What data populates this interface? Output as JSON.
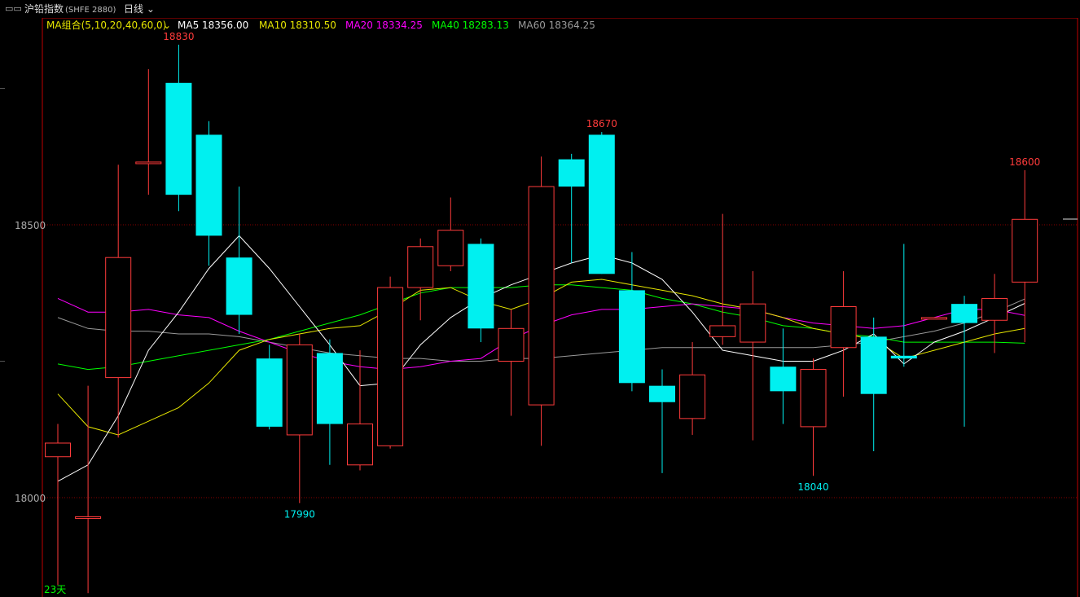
{
  "header": {
    "title": "沪铅指数",
    "code": "(SHFE 2880)",
    "period": "日线",
    "period_icon": "chevron-down-icon",
    "window_icon": "window-icon"
  },
  "ma_legend": {
    "group_label": "MA组合(5,10,20,40,60,0)",
    "ma5": "MA5 18356.00",
    "ma10": "MA10 18310.50",
    "ma20": "MA20 18334.25",
    "ma40": "MA40 18283.13",
    "ma60": "MA60 18364.25"
  },
  "colors": {
    "up": "#ff3b3b",
    "down": "#00f0f0",
    "ma5": "#ffffff",
    "ma10": "#e6e600",
    "ma20": "#ff00ff",
    "ma40": "#00ff00",
    "ma60": "#9a9a9a",
    "frame": "#c00000"
  },
  "chart_data": {
    "type": "candlestick",
    "y_ticks": [
      18000,
      18500
    ],
    "y_range": [
      17850,
      18880
    ],
    "candles": [
      {
        "o": 18075,
        "h": 18135,
        "l": 17840,
        "c": 18100
      },
      {
        "o": 17965,
        "h": 18205,
        "l": 17825,
        "c": 17965
      },
      {
        "o": 18220,
        "h": 18610,
        "l": 18110,
        "c": 18440
      },
      {
        "o": 18615,
        "h": 18785,
        "l": 18555,
        "c": 18615
      },
      {
        "o": 18760,
        "h": 18830,
        "l": 18525,
        "c": 18555
      },
      {
        "o": 18665,
        "h": 18690,
        "l": 18425,
        "c": 18480
      },
      {
        "o": 18440,
        "h": 18570,
        "l": 18300,
        "c": 18335
      },
      {
        "o": 18255,
        "h": 18280,
        "l": 18125,
        "c": 18130
      },
      {
        "o": 18115,
        "h": 18300,
        "l": 17990,
        "c": 18280
      },
      {
        "o": 18265,
        "h": 18290,
        "l": 18060,
        "c": 18135
      },
      {
        "o": 18060,
        "h": 18270,
        "l": 18050,
        "c": 18135
      },
      {
        "o": 18095,
        "h": 18405,
        "l": 18090,
        "c": 18385
      },
      {
        "o": 18385,
        "h": 18475,
        "l": 18325,
        "c": 18460
      },
      {
        "o": 18425,
        "h": 18550,
        "l": 18415,
        "c": 18490
      },
      {
        "o": 18465,
        "h": 18475,
        "l": 18285,
        "c": 18310
      },
      {
        "o": 18250,
        "h": 18345,
        "l": 18150,
        "c": 18310
      },
      {
        "o": 18170,
        "h": 18625,
        "l": 18095,
        "c": 18570
      },
      {
        "o": 18620,
        "h": 18630,
        "l": 18430,
        "c": 18570
      },
      {
        "o": 18665,
        "h": 18670,
        "l": 18410,
        "c": 18410
      },
      {
        "o": 18380,
        "h": 18450,
        "l": 18195,
        "c": 18210
      },
      {
        "o": 18205,
        "h": 18235,
        "l": 18045,
        "c": 18175
      },
      {
        "o": 18145,
        "h": 18285,
        "l": 18115,
        "c": 18225
      },
      {
        "o": 18295,
        "h": 18520,
        "l": 18280,
        "c": 18315
      },
      {
        "o": 18285,
        "h": 18415,
        "l": 18105,
        "c": 18355
      },
      {
        "o": 18240,
        "h": 18310,
        "l": 18135,
        "c": 18195
      },
      {
        "o": 18130,
        "h": 18255,
        "l": 18040,
        "c": 18235
      },
      {
        "o": 18275,
        "h": 18415,
        "l": 18185,
        "c": 18350
      },
      {
        "o": 18295,
        "h": 18330,
        "l": 18085,
        "c": 18190
      },
      {
        "o": 18260,
        "h": 18465,
        "l": 18240,
        "c": 18255
      },
      {
        "o": 18330,
        "h": 18330,
        "l": 18330,
        "c": 18330
      },
      {
        "o": 18355,
        "h": 18370,
        "l": 18130,
        "c": 18320
      },
      {
        "o": 18325,
        "h": 18410,
        "l": 18265,
        "c": 18365
      },
      {
        "o": 18395,
        "h": 18600,
        "l": 18285,
        "c": 18510
      }
    ],
    "ma5": [
      18030,
      18060,
      18150,
      18270,
      18340,
      18420,
      18480,
      18420,
      18350,
      18280,
      18205,
      18210,
      18280,
      18330,
      18365,
      18390,
      18410,
      18430,
      18445,
      18430,
      18400,
      18340,
      18270,
      18260,
      18250,
      18250,
      18270,
      18300,
      18245,
      18285,
      18305,
      18330,
      18356
    ],
    "ma10": [
      18190,
      18130,
      18115,
      18140,
      18165,
      18210,
      18270,
      18290,
      18300,
      18310,
      18315,
      18345,
      18380,
      18385,
      18360,
      18345,
      18365,
      18395,
      18400,
      18390,
      18380,
      18370,
      18355,
      18345,
      18330,
      18310,
      18300,
      18290,
      18255,
      18270,
      18285,
      18300,
      18310
    ],
    "ma20": [
      18365,
      18340,
      18340,
      18345,
      18335,
      18330,
      18305,
      18285,
      18265,
      18250,
      18240,
      18235,
      18240,
      18250,
      18255,
      18290,
      18315,
      18335,
      18345,
      18345,
      18350,
      18355,
      18350,
      18345,
      18330,
      18320,
      18315,
      18310,
      18315,
      18330,
      18345,
      18345,
      18334
    ],
    "ma40": [
      18245,
      18235,
      18240,
      18250,
      18260,
      18270,
      18280,
      18290,
      18305,
      18320,
      18335,
      18355,
      18375,
      18385,
      18385,
      18385,
      18390,
      18390,
      18385,
      18380,
      18365,
      18355,
      18340,
      18330,
      18315,
      18310,
      18300,
      18295,
      18285,
      18285,
      18285,
      18285,
      18283
    ],
    "ma60": [
      18330,
      18310,
      18305,
      18305,
      18300,
      18300,
      18295,
      18285,
      18275,
      18265,
      18260,
      18255,
      18255,
      18250,
      18250,
      18255,
      18255,
      18260,
      18265,
      18270,
      18275,
      18275,
      18275,
      18275,
      18275,
      18275,
      18280,
      18285,
      18295,
      18305,
      18320,
      18340,
      18364
    ],
    "annotations": [
      {
        "label": "18830",
        "color": "up",
        "index": 4,
        "price": 18830,
        "pos": "above"
      },
      {
        "label": "17990",
        "color": "down",
        "index": 8,
        "price": 17990,
        "pos": "below"
      },
      {
        "label": "18670",
        "color": "up",
        "index": 18,
        "price": 18670,
        "pos": "above"
      },
      {
        "label": "18040",
        "color": "down",
        "index": 25,
        "price": 18040,
        "pos": "below"
      },
      {
        "label": "18600",
        "color": "up",
        "index": 32,
        "price": 18600,
        "pos": "above"
      }
    ],
    "bottom_label": "23天"
  }
}
